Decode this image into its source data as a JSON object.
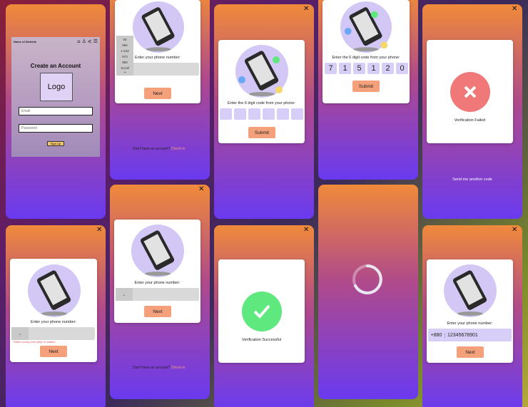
{
  "signup": {
    "website_name": "Name of Website",
    "title": "Create an Account",
    "logo_text": "Logo",
    "email_placeholder": "Email",
    "password_placeholder": "Password",
    "signup_label": "Sign Up"
  },
  "phone_entry": {
    "prompt": "Enter your phone number:",
    "next_label": "Next",
    "no_account_text": "Don't have an account?",
    "check_in_link": "Check in",
    "error_text": "*Select country code (May? is wasted)",
    "country_codes": [
      "93",
      "994",
      "1-242",
      "973",
      "880",
      "Scroll"
    ],
    "filled_code": "+880",
    "filled_number": "12345678901"
  },
  "code_entry": {
    "prompt": "Enter the 6 digit code from your phone:",
    "submit_label": "Submit",
    "entered_digits": [
      "7",
      "1",
      "5",
      "1",
      "2",
      "0"
    ]
  },
  "results": {
    "success_text": "Verification Successful",
    "failed_text": "Verification Failed",
    "resend_text": "Send me another code"
  },
  "colors": {
    "accent_button": "#f4a07a",
    "illustration_circle": "#d3c8f5",
    "success": "#5ee87e",
    "failure": "#f07878",
    "code_box": "#d7cff7"
  }
}
